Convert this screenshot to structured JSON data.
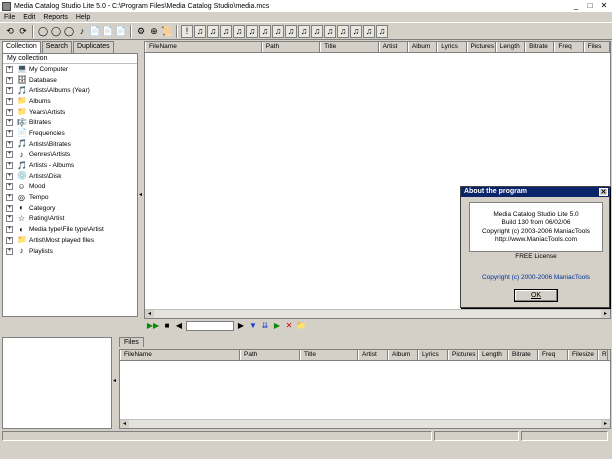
{
  "window": {
    "title": "Media Catalog Studio Lite 5.0 - C:\\Program Files\\Media Catalog Studio\\media.mcs",
    "controls": [
      "_",
      "□",
      "✕"
    ]
  },
  "menu": [
    "File",
    "Edit",
    "Reports",
    "Help"
  ],
  "left_tabs": [
    "Collection",
    "Search",
    "Duplicates"
  ],
  "tree": {
    "root": "My collection",
    "items": [
      {
        "label": "My Computer",
        "icon": "💻"
      },
      {
        "label": "Database",
        "icon": "🗄"
      },
      {
        "label": "Artists\\Albums (Year)",
        "icon": "🎵"
      },
      {
        "label": "Albums",
        "icon": "📁"
      },
      {
        "label": "Years\\Artists",
        "icon": "📁"
      },
      {
        "label": "Bitrates",
        "icon": "🎼"
      },
      {
        "label": "Frequencies",
        "icon": "📄"
      },
      {
        "label": "Artists\\Bitrates",
        "icon": "🎵"
      },
      {
        "label": "Genres\\Artists",
        "icon": "♪"
      },
      {
        "label": "Artists - Albums",
        "icon": "🎵"
      },
      {
        "label": "Artists\\Disk",
        "icon": "💿"
      },
      {
        "label": "Mood",
        "icon": "☺"
      },
      {
        "label": "Tempo",
        "icon": "◎"
      },
      {
        "label": "Category",
        "icon": "◐"
      },
      {
        "label": "Rating\\Artist",
        "icon": "☆"
      },
      {
        "label": "Media type\\File type\\Artist",
        "icon": "◐"
      },
      {
        "label": "Artist\\Most played files",
        "icon": "📁"
      },
      {
        "label": "Playlists",
        "icon": "♪"
      }
    ]
  },
  "main_columns": [
    {
      "label": "FileName",
      "w": 120
    },
    {
      "label": "Path",
      "w": 60
    },
    {
      "label": "Title",
      "w": 60
    },
    {
      "label": "Artist",
      "w": 30
    },
    {
      "label": "Album",
      "w": 30
    },
    {
      "label": "Lyrics",
      "w": 30
    },
    {
      "label": "Pictures",
      "w": 30
    },
    {
      "label": "Length",
      "w": 30
    },
    {
      "label": "Bitrate",
      "w": 30
    },
    {
      "label": "Freq",
      "w": 30
    },
    {
      "label": "Files",
      "w": 27
    }
  ],
  "files_tab": "Files",
  "files_columns": [
    {
      "label": "FileName",
      "w": 120
    },
    {
      "label": "Path",
      "w": 60
    },
    {
      "label": "Title",
      "w": 58
    },
    {
      "label": "Artist",
      "w": 30
    },
    {
      "label": "Album",
      "w": 30
    },
    {
      "label": "Lyrics",
      "w": 30
    },
    {
      "label": "Pictures",
      "w": 30
    },
    {
      "label": "Length",
      "w": 30
    },
    {
      "label": "Bitrate",
      "w": 30
    },
    {
      "label": "Freq",
      "w": 30
    },
    {
      "label": "Filesize",
      "w": 30
    },
    {
      "label": "R",
      "w": 10
    }
  ],
  "dialog": {
    "title": "About the program",
    "close": "✕",
    "lines": [
      "Media Catalog Studio Lite 5.0",
      "Build 130 from 06/02/06",
      "Copyright (c) 2003-2006 ManiacTools",
      "http://www.ManiacTools.com"
    ],
    "license": "FREE License",
    "copyright": "Copyright (c) 2000-2006 ManiacTools",
    "ok": "OK"
  },
  "toolbar": {
    "buttons": [
      "⟲",
      "⟳",
      "◯",
      "◯",
      "◯",
      "♪",
      "📄",
      "📄",
      "📄",
      "⚙",
      "⊕",
      "📜"
    ],
    "ext_buttons": [
      "!",
      "♫",
      "♫",
      "♫",
      "♫",
      "♫",
      "♫",
      "♫",
      "♫",
      "♫",
      "♫",
      "♫",
      "♫",
      "♫",
      "♫",
      "♫"
    ]
  },
  "player": {
    "buttons": [
      "▶▶",
      "■",
      "◀",
      "▶",
      "▼",
      "⇊",
      "▶",
      "✕",
      "📁"
    ]
  },
  "colors": {
    "accent": "#0a246a",
    "window_bg": "#d4d0c8"
  }
}
